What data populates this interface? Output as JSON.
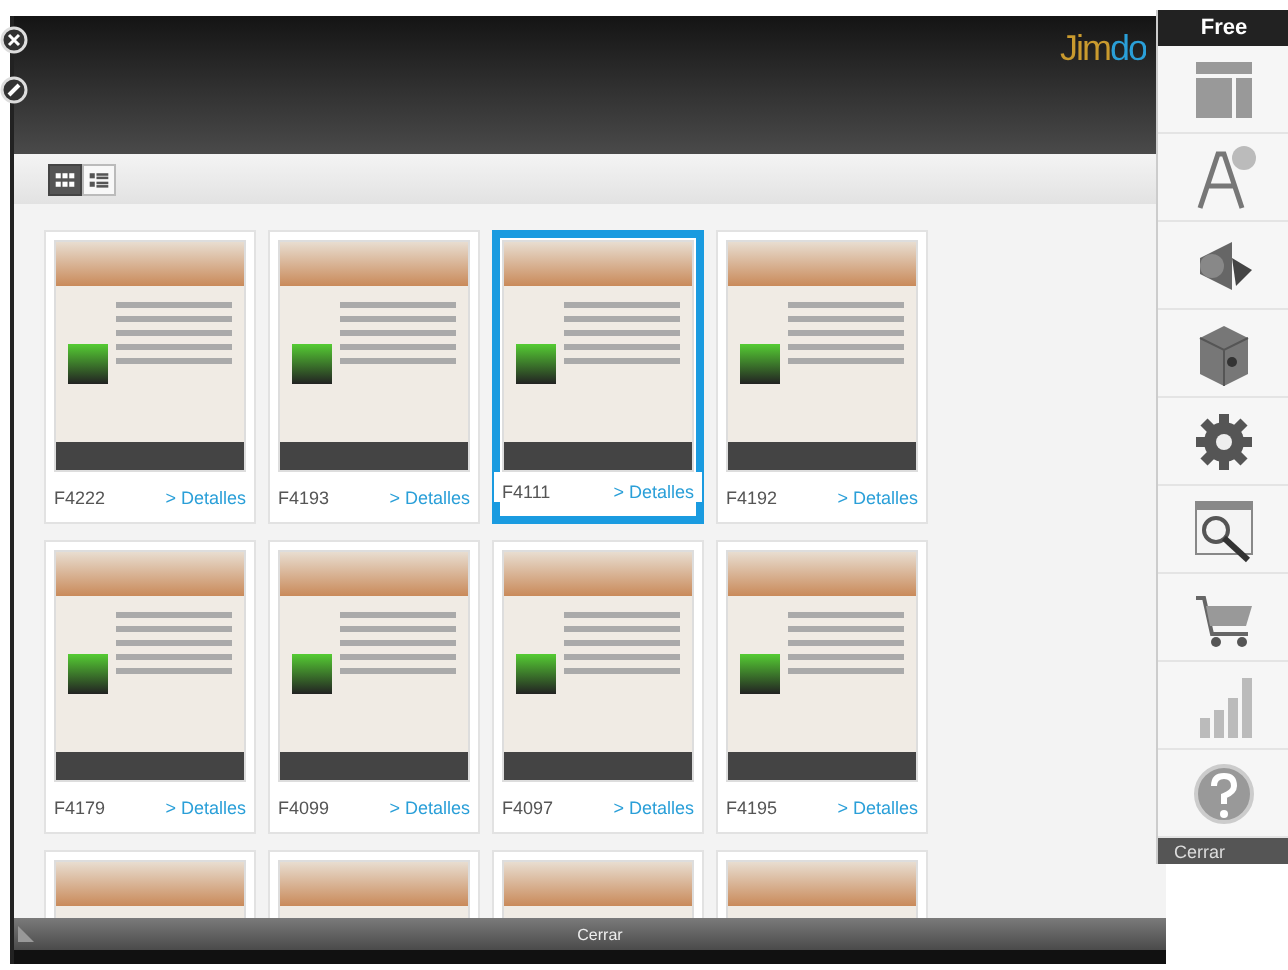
{
  "header": {
    "logo": "Jimdo"
  },
  "view_toggle": [
    {
      "kind": "grid",
      "selected": true
    },
    {
      "kind": "list",
      "selected": false
    }
  ],
  "templates": [
    {
      "code": "F4222",
      "link": "> Detalles",
      "selected": false
    },
    {
      "code": "F4193",
      "link": "> Detalles",
      "selected": false
    },
    {
      "code": "F4111",
      "link": "> Detalles",
      "selected": true
    },
    {
      "code": "F4192",
      "link": "> Detalles",
      "selected": false
    },
    {
      "code": "F4179",
      "link": "> Detalles",
      "selected": false
    },
    {
      "code": "F4099",
      "link": "> Detalles",
      "selected": false
    },
    {
      "code": "F4097",
      "link": "> Detalles",
      "selected": false
    },
    {
      "code": "F4195",
      "link": "> Detalles",
      "selected": false
    },
    {
      "selected": false
    },
    {
      "selected": false
    },
    {
      "selected": false
    },
    {
      "selected": false
    }
  ],
  "bottom_bar": {
    "close": "Cerrar"
  },
  "sidebar": {
    "title": "Free",
    "close": "Cerrar"
  }
}
